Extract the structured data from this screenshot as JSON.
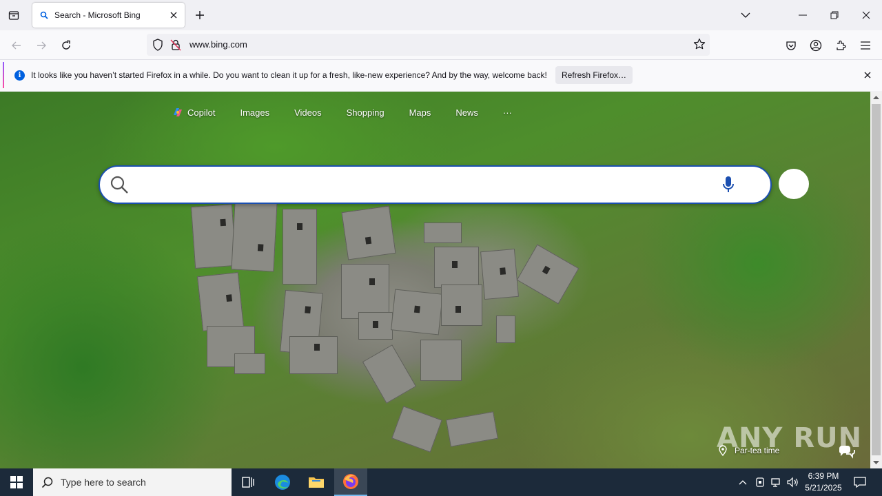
{
  "browser": {
    "tab": {
      "title": "Search - Microsoft Bing"
    },
    "url": "www.bing.com"
  },
  "notification": {
    "message": "It looks like you haven’t started Firefox in a while. Do you want to clean it up for a fresh, like-new experience? And by the way, welcome back!",
    "button_label": "Refresh Firefox…"
  },
  "bing": {
    "nav": [
      "Copilot",
      "Images",
      "Videos",
      "Shopping",
      "Maps",
      "News",
      "···"
    ],
    "search_placeholder": "",
    "location_label": "Par-tea time",
    "watermark": "ANY RUN"
  },
  "taskbar": {
    "search_placeholder": "Type here to search",
    "time": "6:39 PM",
    "date": "5/21/2025"
  },
  "colors": {
    "accent": "#0060df",
    "search_border": "#1b4fb0",
    "taskbar": "#1c2a3a"
  }
}
